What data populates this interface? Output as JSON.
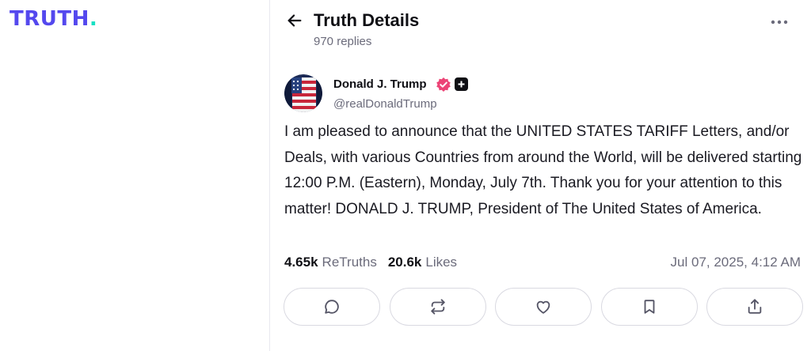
{
  "brand": {
    "logo_text": "TRUTH",
    "logo_dot": ".",
    "accent_color": "#5448ee",
    "dot_color": "#17e0c3"
  },
  "header": {
    "back_icon": "arrow-left-icon",
    "title": "Truth Details",
    "replies": "970 replies",
    "more_icon": "more-horizontal-icon"
  },
  "post": {
    "author_name": "Donald J. Trump",
    "author_handle": "@realDonaldTrump",
    "verified_badge_color": "#ec4476",
    "body": "I am pleased to announce that the UNITED STATES TARIFF Letters, and/or Deals, with various Countries from around the World, will be delivered starting 12:00 P.M. (Eastern), Monday, July 7th. Thank you for your attention to this matter! DONALD J. TRUMP, President of The United States of America.",
    "retruths_count": "4.65k",
    "retruths_label": "ReTruths",
    "likes_count": "20.6k",
    "likes_label": "Likes",
    "timestamp": "Jul 07, 2025, 4:12 AM"
  },
  "actions": [
    {
      "icon": "reply-icon"
    },
    {
      "icon": "retruth-icon"
    },
    {
      "icon": "like-icon"
    },
    {
      "icon": "bookmark-icon"
    },
    {
      "icon": "share-icon"
    }
  ]
}
